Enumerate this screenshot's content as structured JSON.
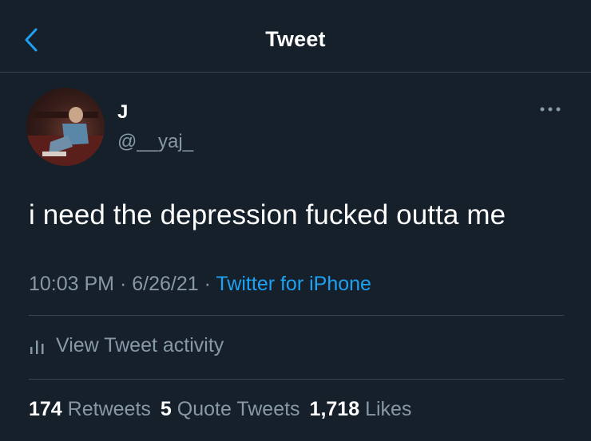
{
  "header": {
    "title": "Tweet",
    "back_icon": "chevron-left-icon"
  },
  "author": {
    "name": "J",
    "handle": "@__yaj_"
  },
  "more_icon": "more-dots-icon",
  "tweet": {
    "text": "i need the depression fucked outta me"
  },
  "meta": {
    "time": "10:03 PM",
    "sep1": " · ",
    "date": "6/26/21",
    "sep2": " · ",
    "source": "Twitter for iPhone"
  },
  "activity": {
    "icon": "bar-chart-icon",
    "label": "View Tweet activity"
  },
  "stats": {
    "retweets_count": "174",
    "retweets_label": "Retweets",
    "quotes_count": "5",
    "quotes_label": "Quote Tweets",
    "likes_count": "1,718",
    "likes_label": "Likes"
  },
  "colors": {
    "background": "#15202b",
    "accent": "#1da1f2",
    "muted": "#8899a6",
    "divider": "#38444d"
  }
}
